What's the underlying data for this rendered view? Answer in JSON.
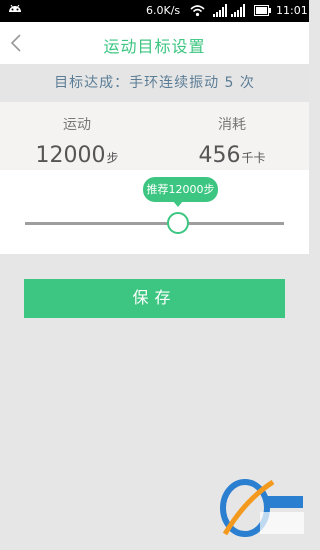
{
  "status_bar": {
    "network_rate": "6.0K/s",
    "time": "11:01",
    "icons": [
      "android-icon",
      "wifi-icon",
      "signal-icon",
      "battery-icon"
    ]
  },
  "header": {
    "title": "运动目标设置",
    "back_icon": "chevron-left-icon"
  },
  "goal_banner": {
    "text": "目标达成：手环连续振动 5 次"
  },
  "stats": {
    "exercise": {
      "label": "运动",
      "value": "12000",
      "unit": "步"
    },
    "calories": {
      "label": "消耗",
      "value": "456",
      "unit": "千卡"
    }
  },
  "slider": {
    "recommend_label": "推荐12000步",
    "value_fraction": 0.59
  },
  "actions": {
    "save_label": "保存"
  },
  "colors": {
    "accent": "#3cc681",
    "banner_text": "#5c7d96",
    "page_background": "#e6e6e6"
  }
}
